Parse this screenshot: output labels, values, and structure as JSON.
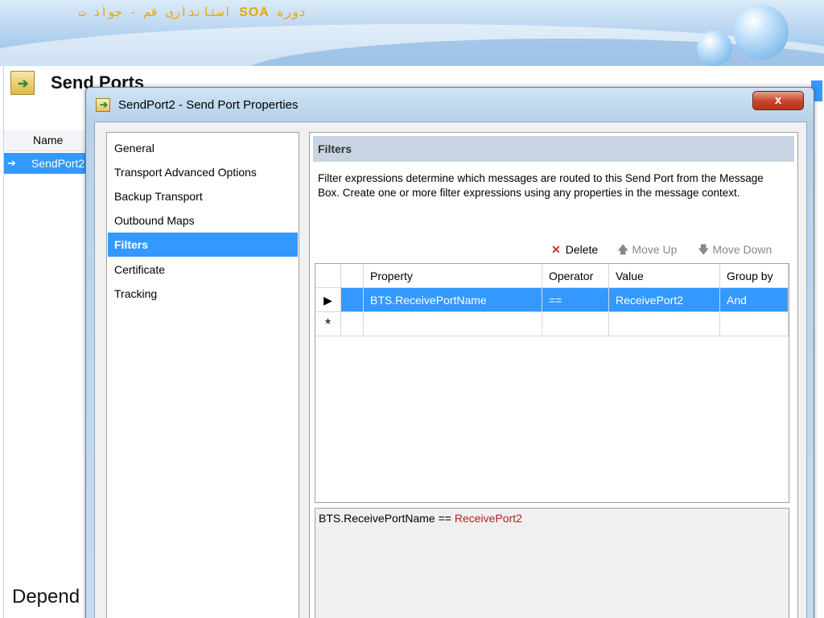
{
  "slide": {
    "title_prefix": "دوره",
    "title_highlight": "SOA",
    "title_suffix": "استانداری قم  -  جواد ت"
  },
  "console": {
    "title": "Send Ports",
    "column_name": "Name",
    "row_item": "SendPort2",
    "bottom_text": "Depend"
  },
  "dialog": {
    "title": "SendPort2 - Send Port Properties",
    "close_label": "x"
  },
  "nav": {
    "items": [
      {
        "label": "General"
      },
      {
        "label": "Transport Advanced Options"
      },
      {
        "label": "Backup Transport"
      },
      {
        "label": "Outbound Maps"
      },
      {
        "label": "Filters"
      },
      {
        "label": "Certificate"
      },
      {
        "label": "Tracking"
      }
    ],
    "selected": "Filters"
  },
  "panel": {
    "header": "Filters",
    "description": "Filter expressions determine which messages are routed to this Send Port from the Message Box. Create one or more filter expressions using any properties in the message context."
  },
  "toolbar": {
    "delete": "Delete",
    "move_up": "Move Up",
    "move_down": "Move Down"
  },
  "grid": {
    "columns": [
      "Property",
      "Operator",
      "Value",
      "Group by"
    ],
    "rows": [
      {
        "property": "BTS.ReceivePortName",
        "operator": "==",
        "value": "ReceivePort2",
        "group_by": "And"
      }
    ],
    "new_row_marker": "*",
    "current_row_marker": "▶"
  },
  "preview": {
    "expression_left": "BTS.ReceivePortName ==",
    "expression_value": "ReceivePort2"
  },
  "colors": {
    "selection": "#3399ff",
    "value_red": "#b22222",
    "accent_orange": "#e7a600"
  }
}
